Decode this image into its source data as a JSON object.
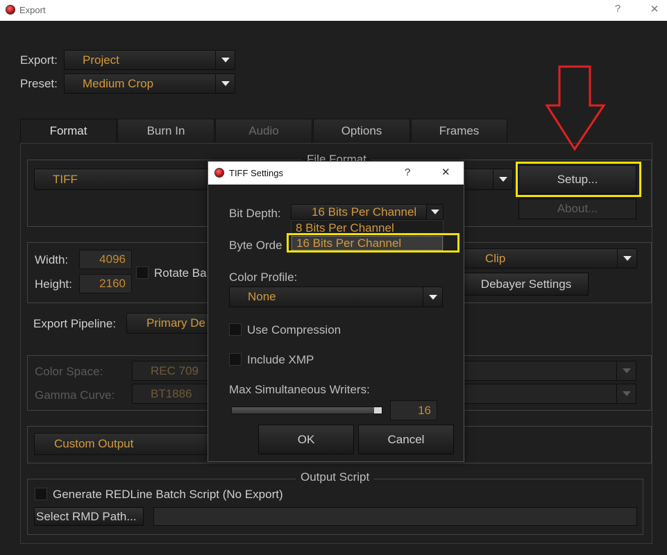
{
  "window": {
    "title": "Export",
    "help": "?",
    "close": "✕"
  },
  "export": {
    "label": "Export:",
    "value": "Project"
  },
  "preset": {
    "label": "Preset:",
    "value": "Medium Crop"
  },
  "tabs": [
    {
      "label": "Format"
    },
    {
      "label": "Burn In"
    },
    {
      "label": "Audio"
    },
    {
      "label": "Options"
    },
    {
      "label": "Frames"
    }
  ],
  "file_format": {
    "legend": "File Format",
    "value": "TIFF",
    "setup_label": "Setup...",
    "about_label": "About..."
  },
  "size": {
    "width_label": "Width:",
    "width_value": "4096",
    "height_label": "Height:",
    "height_value": "2160",
    "rotate_label": "Rotate Ba"
  },
  "clip": {
    "value": "Clip",
    "debayer_label": "Debayer Settings"
  },
  "pipeline": {
    "label": "Export Pipeline:",
    "value": "Primary De"
  },
  "color": {
    "space_label": "Color Space:",
    "space_value": "REC 709",
    "gamma_label": "Gamma Curve:",
    "gamma_value": "BT1886"
  },
  "output": {
    "custom_label": "Custom Output"
  },
  "script": {
    "legend": "Output Script",
    "generate_label": "Generate REDLine Batch Script (No Export)",
    "rmd_label": "Select RMD Path..."
  },
  "tiff_dialog": {
    "title": "TIFF Settings",
    "help": "?",
    "close": "✕",
    "bit_depth_label": "Bit Depth:",
    "bit_depth_value": "16 Bits Per Channel",
    "bit_depth_options": [
      "8 Bits Per Channel",
      "16 Bits Per Channel"
    ],
    "byte_order_label": "Byte Orde",
    "color_profile_label": "Color Profile:",
    "color_profile_value": "None",
    "use_compression_label": "Use Compression",
    "include_xmp_label": "Include XMP",
    "max_writers_label": "Max Simultaneous Writers:",
    "max_writers_value": "16",
    "max_writers_fraction": 1.0,
    "ok_label": "OK",
    "cancel_label": "Cancel"
  },
  "annotation": {
    "arrow_color": "#e32020",
    "highlight_color": "#f2e200"
  }
}
